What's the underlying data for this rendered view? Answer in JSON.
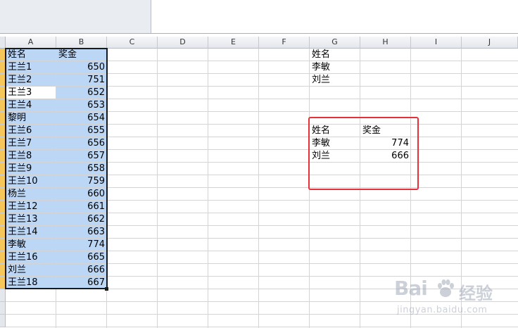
{
  "columns": [
    {
      "label": "A",
      "selected": true
    },
    {
      "label": "B",
      "selected": true
    },
    {
      "label": "C",
      "selected": false
    },
    {
      "label": "D",
      "selected": false
    },
    {
      "label": "E",
      "selected": false
    },
    {
      "label": "F",
      "selected": false
    },
    {
      "label": "G",
      "selected": false
    },
    {
      "label": "H",
      "selected": false
    },
    {
      "label": "I",
      "selected": false
    },
    {
      "label": "J",
      "selected": false
    }
  ],
  "sheet_table": {
    "header": {
      "name": "姓名",
      "bonus": "奖金"
    },
    "rows": [
      {
        "name": "王兰1",
        "bonus": "650"
      },
      {
        "name": "王兰2",
        "bonus": "751"
      },
      {
        "name": "王兰3",
        "bonus": "652"
      },
      {
        "name": "王兰4",
        "bonus": "653"
      },
      {
        "name": "黎明",
        "bonus": "654"
      },
      {
        "name": "王兰6",
        "bonus": "655"
      },
      {
        "name": "王兰7",
        "bonus": "656"
      },
      {
        "name": "王兰8",
        "bonus": "657"
      },
      {
        "name": "王兰9",
        "bonus": "658"
      },
      {
        "name": "王兰10",
        "bonus": "759"
      },
      {
        "name": "杨兰",
        "bonus": "660"
      },
      {
        "name": "王兰12",
        "bonus": "661"
      },
      {
        "name": "王兰13",
        "bonus": "662"
      },
      {
        "name": "王兰14",
        "bonus": "663"
      },
      {
        "name": "李敏",
        "bonus": "774"
      },
      {
        "name": "王兰16",
        "bonus": "665"
      },
      {
        "name": "刘兰",
        "bonus": "666"
      },
      {
        "name": "王兰18",
        "bonus": "667"
      }
    ]
  },
  "lookup_names": {
    "header": "姓名",
    "items": [
      "李敏",
      "刘兰"
    ]
  },
  "result_table": {
    "header": {
      "name": "姓名",
      "bonus": "奖金"
    },
    "rows": [
      {
        "name": "李敏",
        "bonus": "774"
      },
      {
        "name": "刘兰",
        "bonus": "666"
      }
    ]
  },
  "watermark": {
    "brand": "Bai",
    "brand_suffix": "经验",
    "url": "jingyan.baidu.com"
  },
  "colors": {
    "selection": "#bcd6f5",
    "header_selected": "#f5c75a",
    "highlight_box": "#e8303a"
  }
}
